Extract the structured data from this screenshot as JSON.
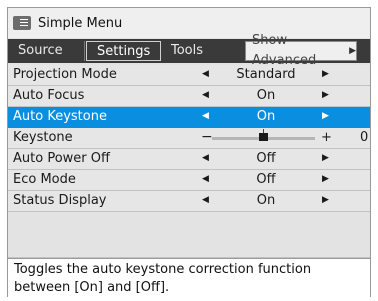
{
  "window": {
    "title": "Simple Menu",
    "icon": "menu-list-icon"
  },
  "tabs": [
    {
      "label": "Source"
    },
    {
      "label": "Settings"
    },
    {
      "label": "Tools"
    }
  ],
  "show_advanced": {
    "label": "Show Advanced",
    "icon": "triangle-right-icon"
  },
  "settings": [
    {
      "label": "Projection Mode",
      "value": "Standard"
    },
    {
      "label": "Auto Focus",
      "value": "On"
    },
    {
      "label": "Auto Keystone",
      "value": "On"
    },
    {
      "label": "Keystone",
      "value": "0",
      "minus": "−",
      "plus": "+",
      "slider_level": 0.5
    },
    {
      "label": "Auto Power Off",
      "value": "Off"
    },
    {
      "label": "Eco Mode",
      "value": "Off"
    },
    {
      "label": "Status Display",
      "value": "On"
    }
  ],
  "selected_setting": "Auto Keystone",
  "selected_tab": "Settings",
  "help_text": "Toggles the auto keystone correction function between [On] and [Off].",
  "colors": {
    "selection": "#0a8fe0",
    "tabbar": "#3a3a3a",
    "panel": "#e6e6e6"
  }
}
